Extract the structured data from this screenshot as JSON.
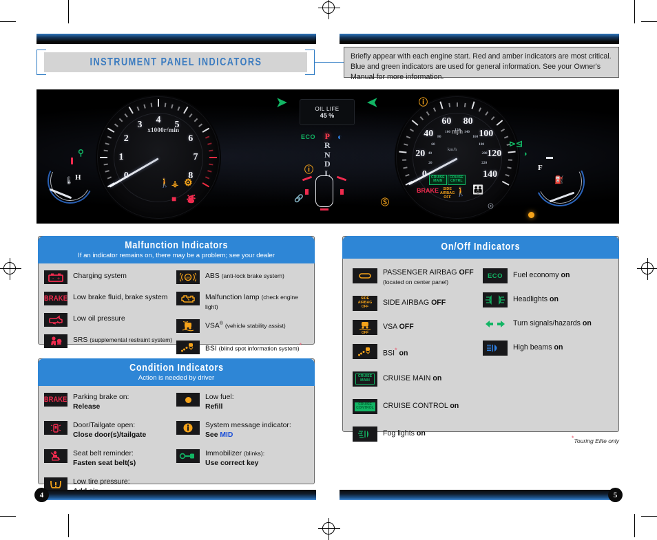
{
  "page": {
    "title": "INSTRUMENT PANEL INDICATORS",
    "left_page_number": "4",
    "right_page_number": "5",
    "footnote": "Touring Elite only",
    "footnote_star": "*"
  },
  "intro": {
    "text": "Briefly appear with each engine start. Red and amber indicators are most critical. Blue and green indicators are used for general information. See your Owner's Manual for more information."
  },
  "colors": {
    "header_blue": "#2e86d6",
    "title_blue": "#3c7cc0",
    "panel_gray": "#d4d4d4",
    "icon_black": "#18181a",
    "red": "#ef2b4e",
    "amber": "#f5a31a",
    "green": "#12b564",
    "blue": "#2f7fe0",
    "mid_blue": "#1b4fd8",
    "star_red": "#e8546a"
  },
  "cluster": {
    "tachometer": {
      "unit_label": "x1000r/min",
      "tick_labels": [
        "0",
        "1",
        "2",
        "3",
        "4",
        "5",
        "6",
        "7",
        "8"
      ],
      "needle_value": 0,
      "redline_start": 6.2
    },
    "speedometer": {
      "unit_label": "mph",
      "inner_unit_label": "km/h",
      "tick_labels": [
        "0",
        "20",
        "40",
        "60",
        "80",
        "100",
        "120",
        "140"
      ],
      "inner_tick_labels": [
        "20",
        "40",
        "60",
        "80",
        "100",
        "120",
        "140",
        "160",
        "180",
        "200",
        "220"
      ],
      "needle_value": 0
    },
    "mid": {
      "line1": "OIL LIFE",
      "line2": "45 %"
    },
    "gear_selector": {
      "positions": [
        "P",
        "R",
        "N",
        "D",
        "L"
      ],
      "selected": "P"
    },
    "temp_gauge": {
      "label": "H"
    },
    "fuel_gauge": {
      "label": "F"
    },
    "active_indicators": [
      "eco",
      "tire-pressure",
      "headlight",
      "immobilizer",
      "turn-left",
      "turn-right",
      "battery",
      "oil-pressure",
      "srs",
      "vsa",
      "check-engine",
      "brake",
      "side-airbag-off",
      "seatbelt",
      "bsi",
      "cruise-main",
      "cruise-control",
      "fog-light",
      "info",
      "low-fuel",
      "abs"
    ]
  },
  "malfunction_panel": {
    "title": "Malfunction Indicators",
    "subtitle": "If an indicator remains on, there may be a problem; see your dealer",
    "left_items": [
      {
        "icon": "battery-icon",
        "color": "red",
        "label": "Charging system",
        "note": ""
      },
      {
        "icon": "brake-text-icon",
        "color": "red",
        "label": "Low brake fluid, brake system",
        "note": ""
      },
      {
        "icon": "oil-can-icon",
        "color": "red",
        "label": "Low oil pressure",
        "note": ""
      },
      {
        "icon": "srs-airbag-icon",
        "color": "red",
        "label": "SRS",
        "note": "(supplemental restraint system)"
      }
    ],
    "right_items": [
      {
        "icon": "abs-icon",
        "color": "amber",
        "label": "ABS",
        "note": "(anti-lock brake system)"
      },
      {
        "icon": "check-engine-icon",
        "color": "amber",
        "label": "Malfunction lamp",
        "note": "(check engine light)"
      },
      {
        "icon": "vsa-icon",
        "color": "amber",
        "label": "VSA",
        "note": "(vehicle stability assist)",
        "sup": "®"
      },
      {
        "icon": "bsi-icon",
        "color": "amber",
        "label": "BSI",
        "note": "(blind spot information system)",
        "star": "*"
      }
    ]
  },
  "condition_panel": {
    "title": "Condition Indicators",
    "subtitle": "Action is needed by driver",
    "left_items": [
      {
        "icon": "brake-text-icon",
        "color": "red",
        "label": "Parking brake on:",
        "action": "Release"
      },
      {
        "icon": "door-open-icon",
        "color": "red",
        "label": "Door/Tailgate open:",
        "action": "Close door(s)/tailgate"
      },
      {
        "icon": "seatbelt-icon",
        "color": "red",
        "label": "Seat belt reminder:",
        "action": "Fasten seat belt(s)"
      },
      {
        "icon": "tire-pressure-icon",
        "color": "amber",
        "label": "Low tire pressure:",
        "action": "Add air"
      }
    ],
    "right_items": [
      {
        "icon": "low-fuel-icon",
        "color": "amber",
        "label": "Low fuel:",
        "action": "Refill"
      },
      {
        "icon": "info-icon",
        "color": "amber",
        "label": "System message indicator:",
        "action": "See ",
        "action_blue": "MID"
      },
      {
        "icon": "immobilizer-icon",
        "color": "green",
        "label": "Immobilizer",
        "note": "(blinks):",
        "action": "Use correct key"
      }
    ]
  },
  "onoff_panel": {
    "title": "On/Off Indicators",
    "left_items": [
      {
        "icon": "passenger-airbag-off-icon",
        "color": "amber",
        "label": "PASSENGER AIRBAG ",
        "bold": "OFF",
        "note": "(located on center panel)"
      },
      {
        "icon": "side-airbag-off-icon",
        "color": "amber",
        "label": "SIDE AIRBAG ",
        "bold": "OFF",
        "note": ""
      },
      {
        "icon": "vsa-off-icon",
        "color": "amber",
        "label": "VSA ",
        "bold": "OFF",
        "note": ""
      },
      {
        "icon": "bsi-icon",
        "color": "amber",
        "label": "BSI",
        "bold": "on",
        "note": "",
        "star": "*"
      },
      {
        "icon": "cruise-main-icon",
        "color": "green",
        "label": "CRUISE MAIN ",
        "bold": "on",
        "note": ""
      },
      {
        "icon": "cruise-control-icon",
        "color": "green",
        "label": "CRUISE CONTROL ",
        "bold": "on",
        "note": ""
      },
      {
        "icon": "fog-light-icon",
        "color": "green",
        "label": "Fog lights ",
        "bold": "on",
        "note": ""
      }
    ],
    "right_items": [
      {
        "icon": "eco-icon",
        "color": "green",
        "label": "Fuel economy ",
        "bold": "on"
      },
      {
        "icon": "headlight-icon",
        "color": "green",
        "label": "Headlights ",
        "bold": "on"
      },
      {
        "icon": "turn-signal-icon",
        "color": "green",
        "label": "Turn signals/hazards ",
        "bold": "on"
      },
      {
        "icon": "high-beam-icon",
        "color": "blue",
        "label": "High beams ",
        "bold": "on"
      }
    ]
  }
}
